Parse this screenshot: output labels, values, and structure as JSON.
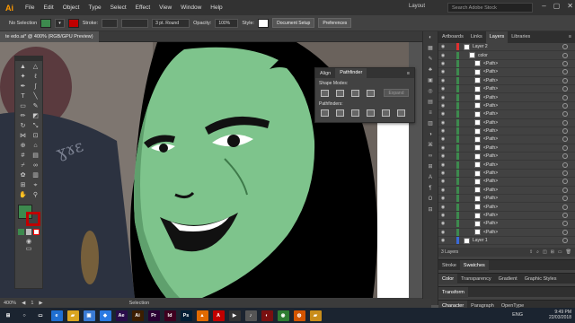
{
  "app": {
    "logo": "Ai"
  },
  "menu": [
    "File",
    "Edit",
    "Object",
    "Type",
    "Select",
    "Effect",
    "View",
    "Window",
    "Help"
  ],
  "workspace": {
    "label": "Layout"
  },
  "search": {
    "placeholder": "Search Adobe Stock"
  },
  "control_bar": {
    "selection_label": "No Selection",
    "fill_color": "#3d8a4e",
    "stroke_label": "Stroke:",
    "stroke_weight": "3 pt. Round",
    "opacity_label": "Opacity:",
    "opacity_value": "100%",
    "style_label": "Style:",
    "doc_setup": "Document Setup",
    "preferences": "Preferences"
  },
  "document_tab": {
    "title": "te edo.ai* @ 400% (RGB/GPU Preview)"
  },
  "pathfinder": {
    "tabs": [
      "Align",
      "Pathfinder"
    ],
    "active_tab": "Pathfinder",
    "shape_modes_label": "Shape Modes:",
    "pathfinders_label": "Pathfinders:",
    "expand_label": "Expand"
  },
  "right_panel": {
    "tabs": [
      "Artboards",
      "Links",
      "Layers",
      "Libraries"
    ],
    "active_tab": "Layers",
    "layers": [
      {
        "name": "Layer 2",
        "indent": 0,
        "bar": "#e03030",
        "thumb": true
      },
      {
        "name": "color",
        "indent": 1,
        "bar": "#3d8a4e",
        "thumb": true
      },
      {
        "name": "<Path>",
        "indent": 2,
        "bar": "#3d8a4e",
        "thumb": true
      },
      {
        "name": "<Path>",
        "indent": 2,
        "bar": "#3d8a4e",
        "thumb": true
      },
      {
        "name": "<Path>",
        "indent": 2,
        "bar": "#3d8a4e",
        "thumb": true
      },
      {
        "name": "<Path>",
        "indent": 2,
        "bar": "#3d8a4e",
        "thumb": true
      },
      {
        "name": "<Path>",
        "indent": 2,
        "bar": "#3d8a4e",
        "thumb": true
      },
      {
        "name": "<Path>",
        "indent": 2,
        "bar": "#3d8a4e",
        "thumb": true
      },
      {
        "name": "<Path>",
        "indent": 2,
        "bar": "#3d8a4e",
        "thumb": true
      },
      {
        "name": "<Path>",
        "indent": 2,
        "bar": "#3d8a4e",
        "thumb": true
      },
      {
        "name": "<Path>",
        "indent": 2,
        "bar": "#3d8a4e",
        "thumb": true
      },
      {
        "name": "<Path>",
        "indent": 2,
        "bar": "#3d8a4e",
        "thumb": true
      },
      {
        "name": "<Path>",
        "indent": 2,
        "bar": "#3d8a4e",
        "thumb": true
      },
      {
        "name": "<Path>",
        "indent": 2,
        "bar": "#3d8a4e",
        "thumb": true
      },
      {
        "name": "<Path>",
        "indent": 2,
        "bar": "#3d8a4e",
        "thumb": true
      },
      {
        "name": "<Path>",
        "indent": 2,
        "bar": "#3d8a4e",
        "thumb": true
      },
      {
        "name": "<Path>",
        "indent": 2,
        "bar": "#3d8a4e",
        "thumb": true
      },
      {
        "name": "<Path>",
        "indent": 2,
        "bar": "#3d8a4e",
        "thumb": true
      },
      {
        "name": "<Path>",
        "indent": 2,
        "bar": "#3d8a4e",
        "thumb": true
      },
      {
        "name": "<Path>",
        "indent": 2,
        "bar": "#3d8a4e",
        "thumb": true
      },
      {
        "name": "<Path>",
        "indent": 2,
        "bar": "#3d8a4e",
        "thumb": true
      },
      {
        "name": "<Path>",
        "indent": 2,
        "bar": "#3d8a4e",
        "thumb": true
      },
      {
        "name": "<Path>",
        "indent": 2,
        "bar": "#3d8a4e",
        "thumb": true
      },
      {
        "name": "Layer 1",
        "indent": 0,
        "bar": "#3a6ad8",
        "thumb": true
      }
    ],
    "layers_count": "3 Layers",
    "stroke_group": [
      "Stroke",
      "Swatches"
    ],
    "color_group": [
      "Color",
      "Transparency",
      "Gradient",
      "Graphic Styles"
    ],
    "transform_group": [
      "Transform"
    ],
    "character_group": [
      "Character",
      "Paragraph",
      "OpenType"
    ]
  },
  "status": {
    "zoom": "400%",
    "page": "1",
    "tool": "Selection"
  },
  "taskbar": {
    "icons": [
      {
        "name": "start-icon",
        "label": "⊞",
        "color": "#1b2430"
      },
      {
        "name": "search-icon",
        "label": "○",
        "color": "#1b2430"
      },
      {
        "name": "task-view-icon",
        "label": "▭",
        "color": "#1b2430"
      },
      {
        "name": "edge-icon",
        "label": "e",
        "color": "#1f6fd0"
      },
      {
        "name": "file-explorer-icon",
        "label": "▰",
        "color": "#d9a520"
      },
      {
        "name": "store-icon",
        "label": "▣",
        "color": "#3a7bd5"
      },
      {
        "name": "dropbox-icon",
        "label": "◆",
        "color": "#2a7ae2"
      },
      {
        "name": "after-effects-icon",
        "label": "Ae",
        "color": "#2a0d4a"
      },
      {
        "name": "illustrator-icon",
        "label": "Ai",
        "color": "#3c1e00"
      },
      {
        "name": "premiere-icon",
        "label": "Pr",
        "color": "#2a0033"
      },
      {
        "name": "indesign-icon",
        "label": "Id",
        "color": "#3e0020"
      },
      {
        "name": "photoshop-icon",
        "label": "Ps",
        "color": "#001e36"
      },
      {
        "name": "vlc-icon",
        "label": "▲",
        "color": "#e06a00"
      },
      {
        "name": "acrobat-icon",
        "label": "A",
        "color": "#c00000"
      },
      {
        "name": "media-player-icon",
        "label": "▶",
        "color": "#333"
      },
      {
        "name": "music-icon",
        "label": "♪",
        "color": "#555"
      },
      {
        "name": "app-icon",
        "label": "◐",
        "color": "#7a1010"
      },
      {
        "name": "chrome-icon",
        "label": "◉",
        "color": "#2e7d32"
      },
      {
        "name": "firefox-icon",
        "label": "◍",
        "color": "#d35400"
      },
      {
        "name": "folder-icon",
        "label": "▰",
        "color": "#c98d1a"
      }
    ],
    "language": "ENG",
    "time": "9:49 PM",
    "date": "22/03/2018"
  }
}
